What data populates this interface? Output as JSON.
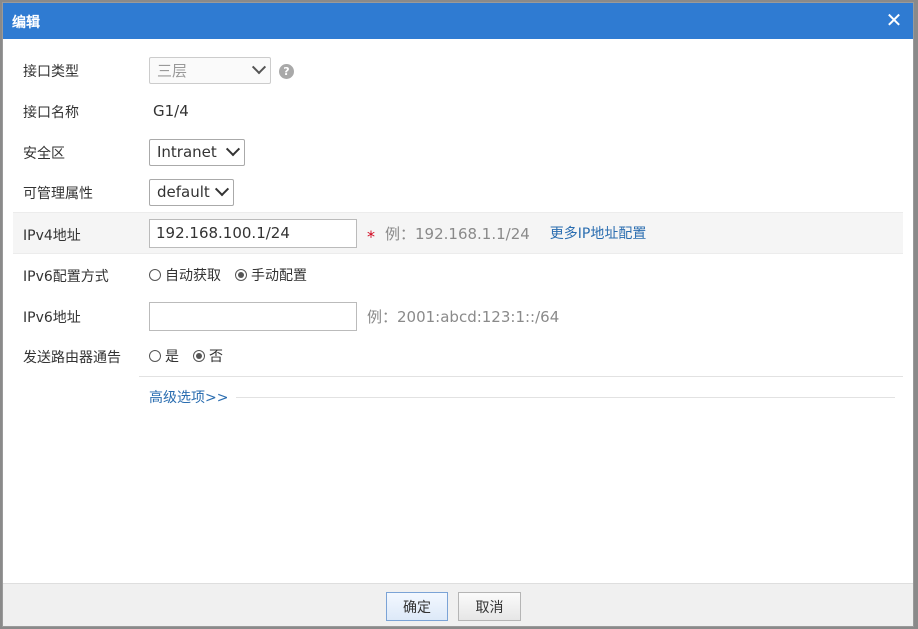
{
  "dialog": {
    "title": "编辑",
    "close_glyph": "✕"
  },
  "fields": {
    "interface_type": {
      "label": "接口类型",
      "value": "三层",
      "help_glyph": "?"
    },
    "interface_name": {
      "label": "接口名称",
      "value": "G1/4"
    },
    "security_zone": {
      "label": "安全区",
      "value": "Intranet"
    },
    "mgmt_attr": {
      "label": "可管理属性",
      "value": "default"
    },
    "ipv4": {
      "label": "IPv4地址",
      "value": "192.168.100.1/24",
      "required_mark": "*",
      "hint": "例：192.168.1.1/24",
      "more_link": "更多IP地址配置"
    },
    "ipv6_mode": {
      "label": "IPv6配置方式",
      "options": [
        "自动获取",
        "手动配置"
      ],
      "selected": "手动配置"
    },
    "ipv6": {
      "label": "IPv6地址",
      "value": "",
      "hint": "例：2001:abcd:123:1::/64"
    },
    "router_adv": {
      "label": "发送路由器通告",
      "options": [
        "是",
        "否"
      ],
      "selected": "否"
    }
  },
  "advanced_link": "高级选项>>",
  "footer": {
    "ok_label": "确定",
    "cancel_label": "取消"
  },
  "colors": {
    "titlebar": "#2f7bd2",
    "link": "#2a6db0",
    "required": "#d0021b"
  },
  "icons": {
    "close": "close-icon",
    "help": "help-icon",
    "dropdown": "chevron-down-icon"
  }
}
